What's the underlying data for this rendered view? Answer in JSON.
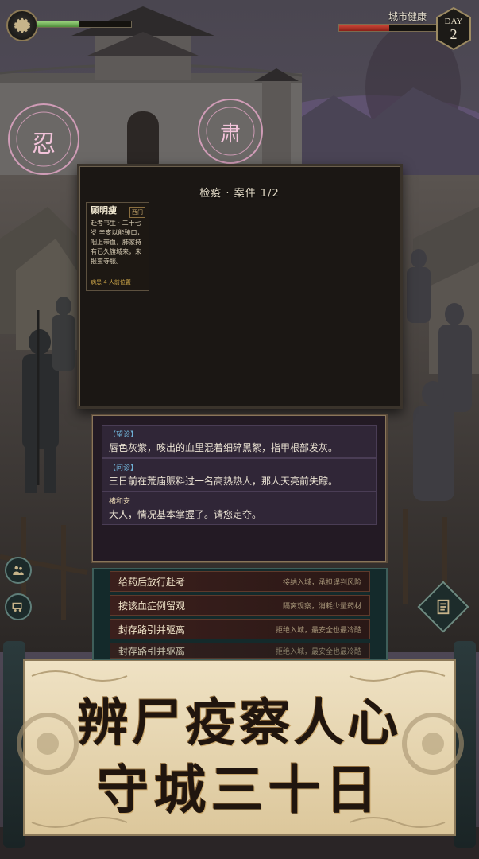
{
  "hud": {
    "player_bar_fill": 0.45,
    "city_health_label": "城市健康",
    "city_health_fill": 0.52,
    "day_label": "DAY",
    "day_number": "2"
  },
  "city_seals": [
    "忍",
    "肃"
  ],
  "case": {
    "title": "检疫 · 案件 1/2",
    "patient": {
      "name": "顾明瘦",
      "tag": "西门",
      "desc": "赴考书生 · 二十七岁 辛亥以能臻口，咽上带血，肺家持有已久旗城来，未报蛮寺服。",
      "footer": "病患 4 人前位置"
    }
  },
  "dialogue": [
    {
      "speaker": "【望诊】",
      "text": "唇色灰紫，咳出的血里混着细碎黑絮，指甲根部发灰。"
    },
    {
      "speaker": "【问诊】",
      "text": "三日前在荒庙赈料过一名高热热人，那人天亮前失踪。"
    },
    {
      "speaker": "褚和安",
      "text": "大人，情况基本掌握了。请您定夺。"
    }
  ],
  "choices": [
    {
      "label": "给药后放行赴考",
      "sub": "接纳入城，承担误判风险"
    },
    {
      "label": "按该血症例留观",
      "sub": "隔离观察，消耗少量药材"
    },
    {
      "label": "封存路引并驱离",
      "sub": "拒绝入城，最安全也最冷酷"
    },
    {
      "label": "封存路引并驱离",
      "sub": "拒绝入城，最安全也最冷酷"
    }
  ],
  "banner": {
    "line1": "辨尸疫察人心",
    "line2": "守城三十日"
  },
  "colors": {
    "accent_gold": "#c9a66a",
    "city_health_red": "#c0392b",
    "player_green": "#7fc163",
    "speaker_blue": "#6fb1d6"
  }
}
